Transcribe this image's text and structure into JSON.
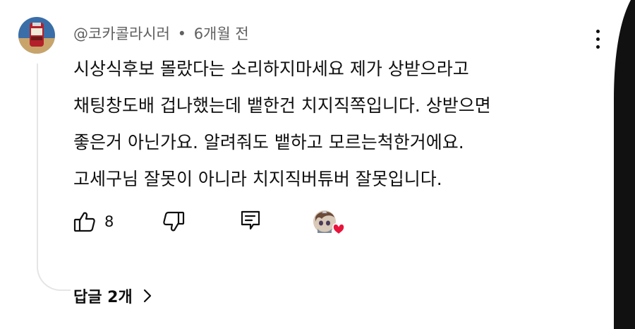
{
  "comment": {
    "author": "@코카콜라시러",
    "separator": "•",
    "timestamp": "6개월 전",
    "lines": [
      "시상식후보 몰랐다는 소리하지마세요 제가 상받으라고",
      "채팅창도배 겁나했는데 뱉한건 치지직쪽입니다. 상받으면",
      "좋은거 아닌가요. 알려줘도 뱉하고 모르는척한거에요.",
      "고세구님 잘못이 아니라 치지직버튜버 잘못입니다."
    ],
    "like_count": "8"
  },
  "replies": {
    "label": "답글 2개"
  },
  "icons": {
    "menu": "more-vertical-icon",
    "like": "thumbs-up-icon",
    "dislike": "thumbs-down-icon",
    "reply": "reply-icon",
    "creator_heart": "creator-heart-icon",
    "chevron": "chevron-right-icon"
  },
  "colors": {
    "text": "#0f0f0f",
    "secondary_text": "#606060",
    "heart": "#e8143c",
    "thread_line": "#e5e5e5"
  }
}
